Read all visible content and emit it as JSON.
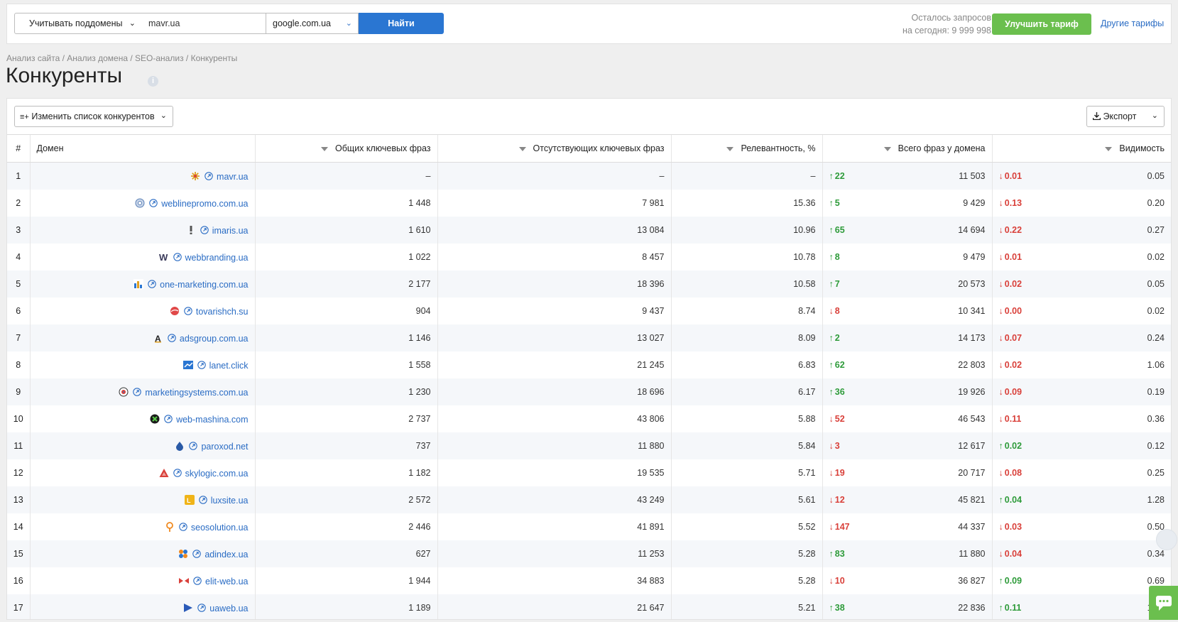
{
  "header": {
    "subdomain_select": "Учитывать поддомены",
    "domain_value": "mavr.ua",
    "engine_select": "google.com.ua",
    "find_label": "Найти",
    "requests_line1": "Осталось запросов",
    "requests_line2": "на сегодня: 9 999 998",
    "upgrade_label": "Улучшить тариф",
    "other_plans_label": "Другие тарифы"
  },
  "breadcrumb": {
    "items": [
      "Анализ сайта",
      "Анализ домена",
      "SEO-анализ",
      "Конкуренты"
    ],
    "sep": " / "
  },
  "page": {
    "title": "Конкуренты"
  },
  "toolbar": {
    "edit_list_label": "Изменить список конкурентов",
    "export_label": "Экспорт"
  },
  "table": {
    "headers": {
      "num": "#",
      "domain": "Домен",
      "common": "Общих ключевых фраз",
      "missing": "Отсутствующих ключевых фраз",
      "relevance": "Релевантность, %",
      "total": "Всего фраз у домена",
      "visibility": "Видимость"
    },
    "rows": [
      {
        "n": "1",
        "domain": "mavr.ua",
        "common": "–",
        "missing": "–",
        "rel": "–",
        "tdir": "up",
        "tdelta": "22",
        "total": "11 503",
        "vdir": "down",
        "vdelta": "0.01",
        "vis": "0.05"
      },
      {
        "n": "2",
        "domain": "weblinepromo.com.ua",
        "common": "1 448",
        "missing": "7 981",
        "rel": "15.36",
        "tdir": "up",
        "tdelta": "5",
        "total": "9 429",
        "vdir": "down",
        "vdelta": "0.13",
        "vis": "0.20"
      },
      {
        "n": "3",
        "domain": "imaris.ua",
        "common": "1 610",
        "missing": "13 084",
        "rel": "10.96",
        "tdir": "up",
        "tdelta": "65",
        "total": "14 694",
        "vdir": "down",
        "vdelta": "0.22",
        "vis": "0.27"
      },
      {
        "n": "4",
        "domain": "webbranding.ua",
        "common": "1 022",
        "missing": "8 457",
        "rel": "10.78",
        "tdir": "up",
        "tdelta": "8",
        "total": "9 479",
        "vdir": "down",
        "vdelta": "0.01",
        "vis": "0.02"
      },
      {
        "n": "5",
        "domain": "one-marketing.com.ua",
        "common": "2 177",
        "missing": "18 396",
        "rel": "10.58",
        "tdir": "up",
        "tdelta": "7",
        "total": "20 573",
        "vdir": "down",
        "vdelta": "0.02",
        "vis": "0.05"
      },
      {
        "n": "6",
        "domain": "tovarishch.su",
        "common": "904",
        "missing": "9 437",
        "rel": "8.74",
        "tdir": "down",
        "tdelta": "8",
        "total": "10 341",
        "vdir": "down",
        "vdelta": "0.00",
        "vis": "0.02"
      },
      {
        "n": "7",
        "domain": "adsgroup.com.ua",
        "common": "1 146",
        "missing": "13 027",
        "rel": "8.09",
        "tdir": "up",
        "tdelta": "2",
        "total": "14 173",
        "vdir": "down",
        "vdelta": "0.07",
        "vis": "0.24"
      },
      {
        "n": "8",
        "domain": "lanet.click",
        "common": "1 558",
        "missing": "21 245",
        "rel": "6.83",
        "tdir": "up",
        "tdelta": "62",
        "total": "22 803",
        "vdir": "down",
        "vdelta": "0.02",
        "vis": "1.06"
      },
      {
        "n": "9",
        "domain": "marketingsystems.com.ua",
        "common": "1 230",
        "missing": "18 696",
        "rel": "6.17",
        "tdir": "up",
        "tdelta": "36",
        "total": "19 926",
        "vdir": "down",
        "vdelta": "0.09",
        "vis": "0.19"
      },
      {
        "n": "10",
        "domain": "web-mashina.com",
        "common": "2 737",
        "missing": "43 806",
        "rel": "5.88",
        "tdir": "down",
        "tdelta": "52",
        "total": "46 543",
        "vdir": "down",
        "vdelta": "0.11",
        "vis": "0.36"
      },
      {
        "n": "11",
        "domain": "paroxod.net",
        "common": "737",
        "missing": "11 880",
        "rel": "5.84",
        "tdir": "down",
        "tdelta": "3",
        "total": "12 617",
        "vdir": "up",
        "vdelta": "0.02",
        "vis": "0.12"
      },
      {
        "n": "12",
        "domain": "skylogic.com.ua",
        "common": "1 182",
        "missing": "19 535",
        "rel": "5.71",
        "tdir": "down",
        "tdelta": "19",
        "total": "20 717",
        "vdir": "down",
        "vdelta": "0.08",
        "vis": "0.25"
      },
      {
        "n": "13",
        "domain": "luxsite.ua",
        "common": "2 572",
        "missing": "43 249",
        "rel": "5.61",
        "tdir": "down",
        "tdelta": "12",
        "total": "45 821",
        "vdir": "up",
        "vdelta": "0.04",
        "vis": "1.28"
      },
      {
        "n": "14",
        "domain": "seosolution.ua",
        "common": "2 446",
        "missing": "41 891",
        "rel": "5.52",
        "tdir": "down",
        "tdelta": "147",
        "total": "44 337",
        "vdir": "down",
        "vdelta": "0.03",
        "vis": "0.50"
      },
      {
        "n": "15",
        "domain": "adindex.ua",
        "common": "627",
        "missing": "11 253",
        "rel": "5.28",
        "tdir": "up",
        "tdelta": "83",
        "total": "11 880",
        "vdir": "down",
        "vdelta": "0.04",
        "vis": "0.34"
      },
      {
        "n": "16",
        "domain": "elit-web.ua",
        "common": "1 944",
        "missing": "34 883",
        "rel": "5.28",
        "tdir": "down",
        "tdelta": "10",
        "total": "36 827",
        "vdir": "up",
        "vdelta": "0.09",
        "vis": "0.69"
      },
      {
        "n": "17",
        "domain": "uaweb.ua",
        "common": "1 189",
        "missing": "21 647",
        "rel": "5.21",
        "tdir": "up",
        "tdelta": "38",
        "total": "22 836",
        "vdir": "up",
        "vdelta": "0.11",
        "vis": "1.18"
      }
    ]
  },
  "favicons": [
    "asterisk-favicon",
    "globe-favicon",
    "exclamation-favicon",
    "w-favicon",
    "chart-favicon",
    "red-ball-favicon",
    "a-favicon",
    "blue-flag-favicon",
    "target-favicon",
    "x-circle-favicon",
    "drop-favicon",
    "triangle-favicon",
    "yellow-square-favicon",
    "pin-favicon",
    "gear-favicon",
    "bowtie-favicon",
    "play-favicon"
  ],
  "colors": {
    "link": "#2a6cc4",
    "up": "#2e9b3a",
    "down": "#d9403a",
    "primary": "#2a76d2",
    "green": "#6bbf4e"
  }
}
